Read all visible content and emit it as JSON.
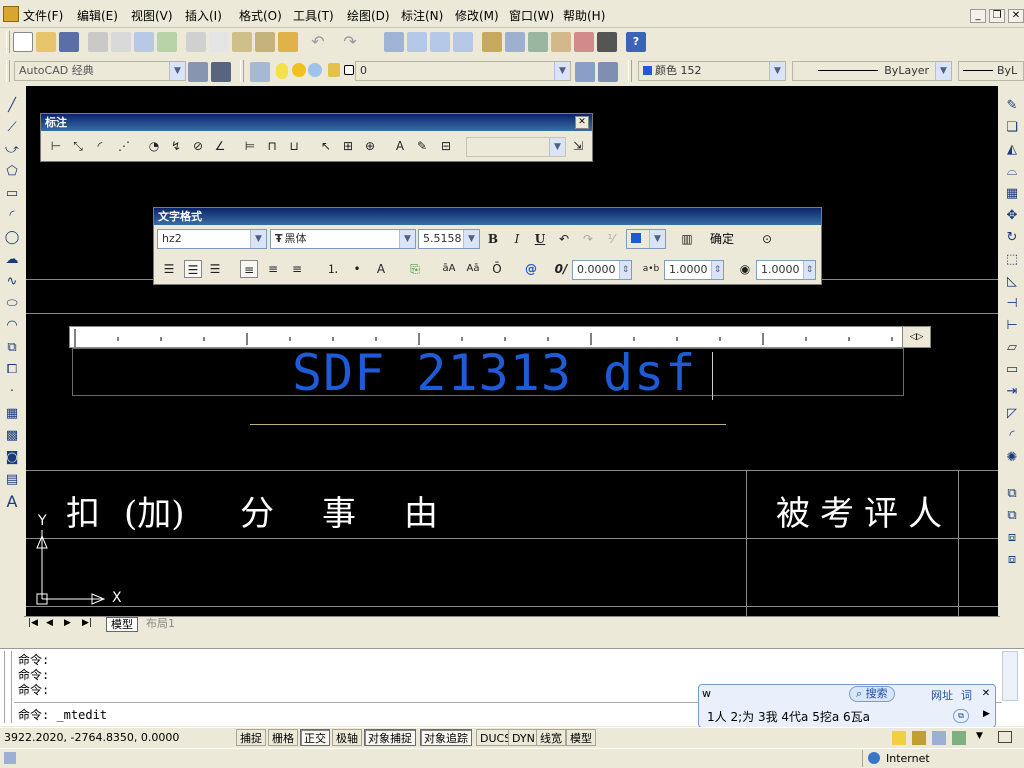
{
  "menu": [
    "文件(F)",
    "编辑(E)",
    "视图(V)",
    "插入(I)",
    "格式(O)",
    "工具(T)",
    "绘图(D)",
    "标注(N)",
    "修改(M)",
    "窗口(W)",
    "帮助(H)"
  ],
  "workspace": "AutoCAD 经典",
  "layer": "0",
  "color_combo": "颜色 152",
  "linetype": "ByLayer",
  "linetype2": "ByL",
  "dim_toolbar": {
    "title": "标注",
    "close": "✕"
  },
  "text_format": {
    "title": "文字格式",
    "style": "hz2",
    "font": "黑体",
    "height": "5.5158",
    "ok": "确定",
    "oblique": "0.0000",
    "tracking": "1.0000",
    "width": "1.0000",
    "bold": "B",
    "italic": "I",
    "underline": "U"
  },
  "mtext": {
    "content": "SDF 21313 dsf"
  },
  "drawing": {
    "left_label": [
      "扣",
      "(加)",
      "分",
      "事",
      "由"
    ],
    "right_label": "被考评人",
    "ucs_y": "Y",
    "ucs_x": "X"
  },
  "layout_tabs": {
    "model": "模型",
    "layout1": "布局1"
  },
  "command": {
    "lines": [
      "命令:",
      "命令:",
      "命令:"
    ],
    "current": "命令: _mtedit"
  },
  "ime": {
    "input": "w",
    "search": "搜索",
    "web": "网址",
    "word": "词",
    "candidates": "1人 2;为 3我 4代a 5挖a 6瓦a"
  },
  "status": {
    "coords": "3922.2020, -2764.8350, 0.0000",
    "buttons": [
      "捕捉",
      "栅格",
      "正交",
      "极轴",
      "对象捕捉",
      "对象追踪",
      "DUCS",
      "DYN",
      "线宽",
      "模型"
    ]
  },
  "taskbar": {
    "zone": "Internet"
  },
  "colors": {
    "text_blue": "#1e5bd6",
    "canvas": "#000000",
    "titlebar": "#0a246a"
  }
}
